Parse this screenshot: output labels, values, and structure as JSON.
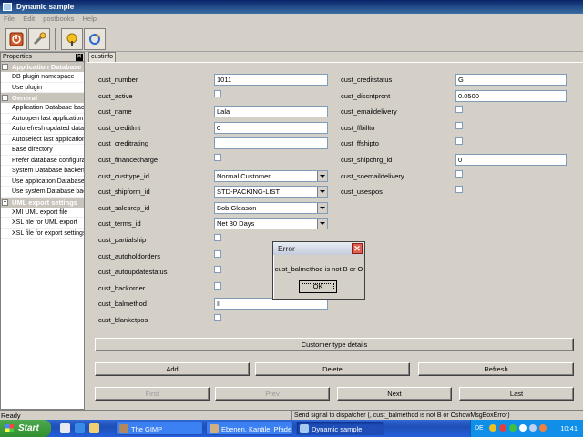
{
  "window": {
    "title": "Dynamic sample"
  },
  "menu": [
    "File",
    "Edit",
    "postbooks",
    "Help"
  ],
  "toolbar": {
    "icons": [
      "exit-icon",
      "wrench-icon",
      "run-icon",
      "refresh-icon"
    ]
  },
  "properties": {
    "header": "Properties",
    "close_glyph": "✕",
    "sections": [
      {
        "title": "Application Database",
        "items": [
          "DB plugin namespace",
          "Use plugin"
        ]
      },
      {
        "title": "General",
        "items": [
          "Application Database backend",
          "Autoopen last application",
          "Autorefresh updated data",
          "Autoselect last application",
          "Base directory",
          "Prefer database configuration",
          "System Database backend",
          "Use application Database",
          "Use system Database backend"
        ]
      },
      {
        "title": "UML export settings",
        "items": [
          "XMI UML export file",
          "XSL file for UML export",
          "XSL file for export settings"
        ]
      }
    ]
  },
  "tab": {
    "label": "custinfo"
  },
  "form": {
    "left": [
      {
        "label": "cust_number",
        "kind": "text",
        "value": "1011"
      },
      {
        "label": "cust_active",
        "kind": "check"
      },
      {
        "label": "cust_name",
        "kind": "text",
        "value": "Lala"
      },
      {
        "label": "cust_creditlmt",
        "kind": "text",
        "value": "0"
      },
      {
        "label": "cust_creditrating",
        "kind": "text",
        "value": ""
      },
      {
        "label": "cust_financecharge",
        "kind": "check"
      },
      {
        "label": "cust_custtype_id",
        "kind": "combo",
        "value": "Normal Customer"
      },
      {
        "label": "cust_shipform_id",
        "kind": "combo",
        "value": "STD-PACKING-LIST"
      },
      {
        "label": "cust_salesrep_id",
        "kind": "combo",
        "value": "Bob Gleason"
      },
      {
        "label": "cust_terms_id",
        "kind": "combo",
        "value": "Net 30 Days"
      },
      {
        "label": "cust_partialship",
        "kind": "check"
      },
      {
        "label": "cust_autoholdorders",
        "kind": "check"
      },
      {
        "label": "cust_autoupdatestatus",
        "kind": "check"
      },
      {
        "label": "cust_backorder",
        "kind": "check"
      },
      {
        "label": "cust_balmethod",
        "kind": "text",
        "value": "II"
      },
      {
        "label": "cust_blanketpos",
        "kind": "check"
      }
    ],
    "right": [
      {
        "label": "cust_creditstatus",
        "kind": "text",
        "value": "G"
      },
      {
        "label": "cust_discntprcnt",
        "kind": "text",
        "value": "0.0500"
      },
      {
        "label": "cust_emaildelivery",
        "kind": "check"
      },
      {
        "label": "cust_ffbillto",
        "kind": "check"
      },
      {
        "label": "cust_ffshipto",
        "kind": "check"
      },
      {
        "label": "cust_shipchrg_id",
        "kind": "text",
        "value": "0"
      },
      {
        "label": "cust_soemaildelivery",
        "kind": "check"
      },
      {
        "label": "cust_usespos",
        "kind": "check"
      }
    ]
  },
  "buttons": {
    "customer_type_details": "Customer type details",
    "add": "Add",
    "delete": "Delete",
    "refresh": "Refresh",
    "first": "First",
    "prev": "Prev",
    "next": "Next",
    "last": "Last"
  },
  "dialog": {
    "title": "Error",
    "close_glyph": "✕",
    "message": "cust_balmethod is not B or O",
    "ok": "OK"
  },
  "status": {
    "left": "Ready",
    "right": "Send signal to dispatcher (, cust_balmethod is not B or OshowMsgBoxError)"
  },
  "taskbar": {
    "start": "Start",
    "tasks": [
      {
        "label": "The GIMP",
        "active": false
      },
      {
        "label": "Ebenen, Kanäle, Pfade...",
        "active": false
      },
      {
        "label": "Dynamic sample",
        "active": true
      }
    ],
    "lang": "DE",
    "clock": "10:41"
  },
  "colors": {
    "title_bar": "#0a246a",
    "taskbar": "#245edb",
    "start": "#2f8f2f",
    "error_close": "#e06050"
  }
}
